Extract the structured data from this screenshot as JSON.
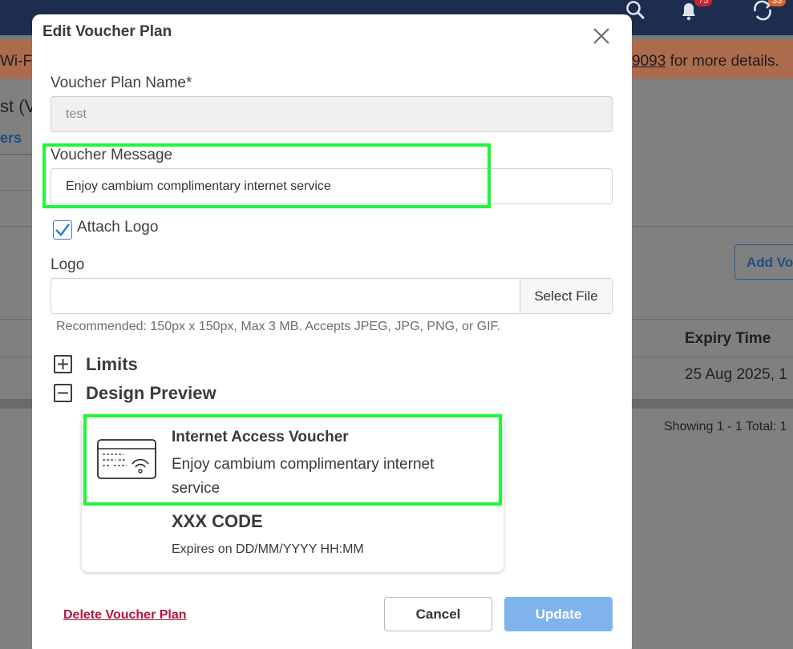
{
  "background": {
    "notification_count": "75",
    "other_count": "33",
    "banner_left": "Wi-F",
    "banner_link": "9093",
    "banner_right": "for more details.",
    "page_title": "st (V",
    "tab_label": "ers",
    "add_button": "Add Vo",
    "table_header": "Expiry Time",
    "table_cell": "25 Aug 2025, 1",
    "pagination": "Showing 1 - 1 Total: 1"
  },
  "modal": {
    "title": "Edit Voucher Plan",
    "plan_name_label": "Voucher Plan Name*",
    "plan_name_value": "test",
    "message_label": "Voucher Message",
    "message_value": "Enjoy cambium complimentary internet service",
    "attach_logo_label": "Attach Logo",
    "attach_logo_checked": true,
    "logo_label": "Logo",
    "select_file_label": "Select File",
    "logo_hint": "Recommended: 150px x 150px, Max 3 MB. Accepts JPEG, JPG, PNG, or GIF.",
    "limits_label": "Limits",
    "design_preview_label": "Design Preview",
    "preview": {
      "title": "Internet Access Voucher",
      "message": "Enjoy cambium complimentary internet service",
      "code": "XXX CODE",
      "expires": "Expires on DD/MM/YYYY HH:MM",
      "icon": "voucher-wifi-icon"
    },
    "delete_label": "Delete Voucher Plan",
    "cancel_label": "Cancel",
    "update_label": "Update"
  },
  "colors": {
    "highlight": "#21f53a",
    "update_button": "#7fb3ec",
    "delete_link": "#b3143c",
    "header": "#1e2d4f"
  }
}
